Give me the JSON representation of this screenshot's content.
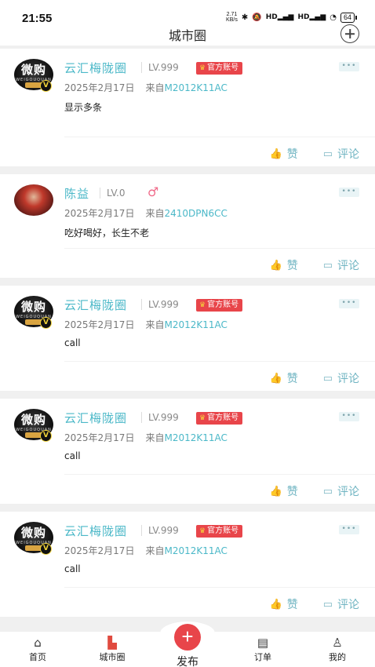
{
  "status_bar": {
    "time": "21:55",
    "net_speed_value": "2.71",
    "net_speed_unit": "KB/s",
    "bluetooth_icon": "bluetooth-icon",
    "signal_1": "HD",
    "signal_2": "HD",
    "battery": "64"
  },
  "header": {
    "title": "城市圈",
    "add_icon": "plus-circle-icon"
  },
  "posts": [
    {
      "name": "云汇梅陇圈",
      "level": "LV.999",
      "badge": "官方账号",
      "avatar": "weigou-logo",
      "avatar_text": "微购",
      "avatar_sub": "WEIGOUQUAN",
      "verified": "V",
      "date": "2025年2月17日",
      "from_label": "来自",
      "device": "M2012K11AC",
      "content": "显示多条",
      "like_label": "赞",
      "comment_label": "评论",
      "more": "•••"
    },
    {
      "name": "陈益",
      "level": "LV.0",
      "gender": "♂",
      "avatar": "user-photo",
      "date": "2025年2月17日",
      "from_label": "来自",
      "device": "2410DPN6CC",
      "content": "吃好喝好，长生不老",
      "like_label": "赞",
      "comment_label": "评论",
      "more": "•••"
    },
    {
      "name": "云汇梅陇圈",
      "level": "LV.999",
      "badge": "官方账号",
      "avatar": "weigou-logo",
      "avatar_text": "微购",
      "avatar_sub": "WEIGOUQUAN",
      "verified": "V",
      "date": "2025年2月17日",
      "from_label": "来自",
      "device": "M2012K11AC",
      "content": "call",
      "like_label": "赞",
      "comment_label": "评论",
      "more": "•••"
    },
    {
      "name": "云汇梅陇圈",
      "level": "LV.999",
      "badge": "官方账号",
      "avatar": "weigou-logo",
      "avatar_text": "微购",
      "avatar_sub": "WEIGOUQUAN",
      "verified": "V",
      "date": "2025年2月17日",
      "from_label": "来自",
      "device": "M2012K11AC",
      "content": "call",
      "like_label": "赞",
      "comment_label": "评论",
      "more": "•••"
    },
    {
      "name": "云汇梅陇圈",
      "level": "LV.999",
      "badge": "官方账号",
      "avatar": "weigou-logo",
      "avatar_text": "微购",
      "avatar_sub": "WEIGOUQUAN",
      "verified": "V",
      "date": "2025年2月17日",
      "from_label": "来自",
      "device": "M2012K11AC",
      "content": "call",
      "like_label": "赞",
      "comment_label": "评论",
      "more": "•••"
    }
  ],
  "tabbar": {
    "home": "首页",
    "city": "城市圈",
    "publish": "发布",
    "publish_icon": "+",
    "orders": "订单",
    "mine": "我的",
    "active": "城市圈"
  },
  "colors": {
    "accent": "#4bb8c8",
    "badge_red": "#e8454a",
    "action": "#6fb4c2"
  }
}
